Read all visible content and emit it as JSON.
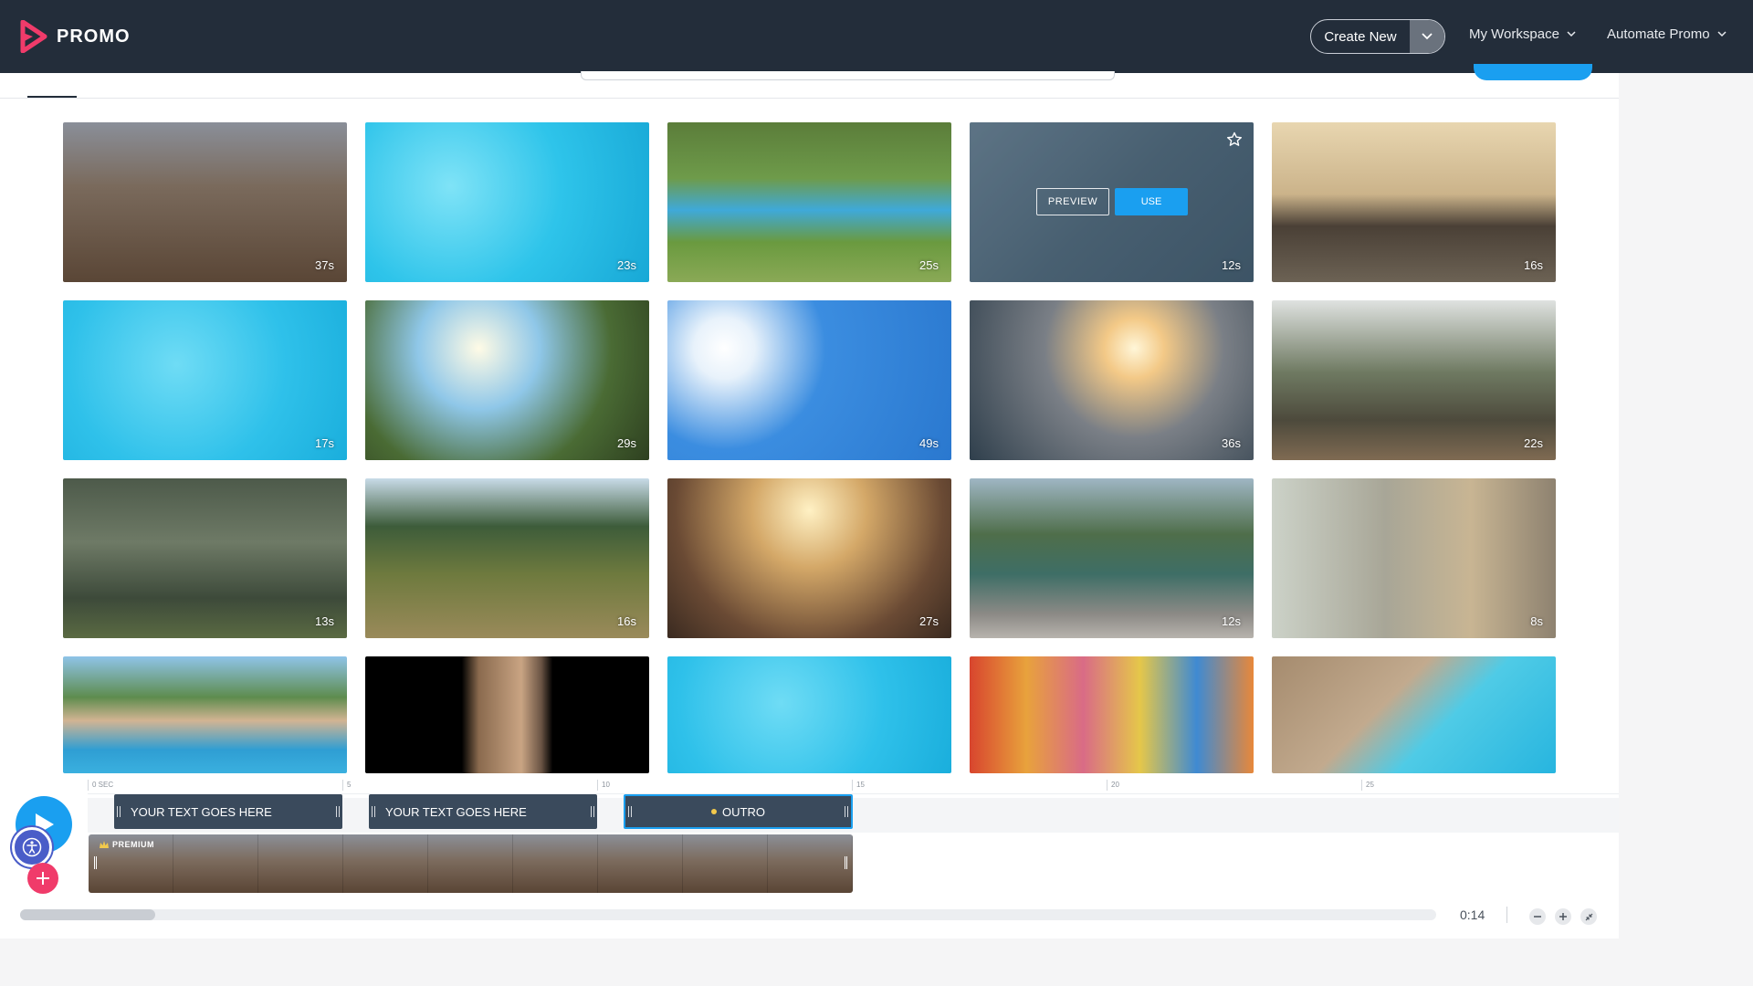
{
  "header": {
    "logo_text": "PROMO",
    "create_new_label": "Create New",
    "nav": [
      {
        "label": "My Workspace"
      },
      {
        "label": "Automate Promo"
      }
    ]
  },
  "colors": {
    "header_bg": "#232d3a",
    "accent_blue": "#1a9ff0",
    "logo_pink": "#f03b6a",
    "accessibility_blue": "#4a5dc8"
  },
  "tiles": [
    {
      "duration": "37s",
      "theme": "festival-crowd"
    },
    {
      "duration": "23s",
      "theme": "pool-swimmers"
    },
    {
      "duration": "25s",
      "theme": "backyard-pool"
    },
    {
      "duration": "12s",
      "theme": "water-surface",
      "hovered": true
    },
    {
      "duration": "16s",
      "theme": "boat-sunset"
    },
    {
      "duration": "17s",
      "theme": "pool-water"
    },
    {
      "duration": "29s",
      "theme": "meadow-sunset"
    },
    {
      "duration": "49s",
      "theme": "blue-sky"
    },
    {
      "duration": "36s",
      "theme": "lake-sunset"
    },
    {
      "duration": "22s",
      "theme": "porch-couple"
    },
    {
      "duration": "13s",
      "theme": "backyard-bbq"
    },
    {
      "duration": "16s",
      "theme": "hill-trail"
    },
    {
      "duration": "27s",
      "theme": "festival-dance"
    },
    {
      "duration": "12s",
      "theme": "mountain-lake"
    },
    {
      "duration": "8s",
      "theme": "fan-room"
    },
    {
      "duration": "",
      "theme": "pool-party"
    },
    {
      "duration": "",
      "theme": "dancer-vertical"
    },
    {
      "duration": "",
      "theme": "pool-water"
    },
    {
      "duration": "",
      "theme": "colorful-town"
    },
    {
      "duration": "",
      "theme": "sunglasses-pool"
    }
  ],
  "hover_actions": {
    "preview_label": "PREVIEW",
    "use_label": "USE",
    "star_icon": "star-outline-icon"
  },
  "timeline": {
    "ruler": [
      "0 SEC",
      "5",
      "10",
      "15",
      "20",
      "25"
    ],
    "clips": [
      {
        "label": "YOUR TEXT GOES HERE"
      },
      {
        "label": "YOUR TEXT GOES HERE"
      },
      {
        "label": "OUTRO"
      }
    ],
    "video_badge": "PREMIUM",
    "time_readout": "0:14"
  }
}
